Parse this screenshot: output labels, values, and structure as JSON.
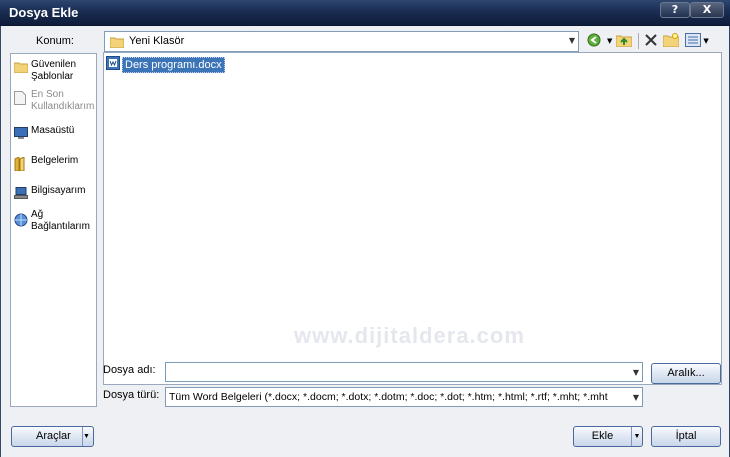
{
  "window": {
    "title": "Dosya Ekle",
    "help_label": "?",
    "close_label": "X"
  },
  "location": {
    "label": "Konum:",
    "value": "Yeni Klasör"
  },
  "places": [
    {
      "line1": "Güvenilen",
      "line2": "Şablonlar",
      "icon": "folder-icon",
      "disabled": false
    },
    {
      "line1": "En Son",
      "line2": "Kullandıklarım",
      "icon": "recent-docs-icon",
      "disabled": true
    },
    {
      "line1": "Masaüstü",
      "line2": "",
      "icon": "desktop-icon",
      "disabled": false
    },
    {
      "line1": "Belgelerim",
      "line2": "",
      "icon": "documents-icon",
      "disabled": false
    },
    {
      "line1": "Bilgisayarım",
      "line2": "",
      "icon": "computer-icon",
      "disabled": false
    },
    {
      "line1": "Ağ",
      "line2": "Bağlantılarım",
      "icon": "network-icon",
      "disabled": false
    }
  ],
  "files": [
    {
      "name": "Ders programı.docx",
      "icon": "word-document-icon",
      "selected": true
    }
  ],
  "watermark": "www.dijitaldera.com",
  "filename": {
    "label": "Dosya adı:",
    "value": ""
  },
  "filetype": {
    "label": "Dosya türü:",
    "value": "Tüm Word Belgeleri (*.docx; *.docm; *.dotx; *.dotm; *.doc; *.dot; *.htm; *.html; *.rtf; *.mht; *.mht"
  },
  "buttons": {
    "range": "Aralık...",
    "tools": "Araçlar",
    "insert": "Ekle",
    "cancel": "İptal"
  }
}
